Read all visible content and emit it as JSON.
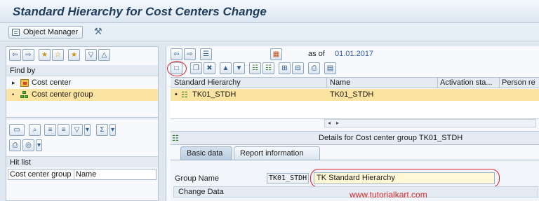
{
  "title": "Standard Hierarchy for Cost Centers Change",
  "app_toolbar": {
    "object_manager_label": "Object Manager"
  },
  "left_panel": {
    "find_by_label": "Find by",
    "tree_items": [
      {
        "label": "Cost center",
        "icon": "cost-center-icon",
        "selected": false
      },
      {
        "label": "Cost center group",
        "icon": "cost-center-group-icon",
        "selected": true
      }
    ],
    "hit_list_label": "Hit list",
    "hit_list_columns": [
      "Cost center group",
      "Name"
    ]
  },
  "right_panel": {
    "as_of_label": "as of",
    "as_of_date": "01.01.2017",
    "columns": [
      "Standard Hierarchy",
      "Name",
      "Activation sta...",
      "Person re"
    ],
    "rows": [
      {
        "standard_hierarchy": "TK01_STDH",
        "name": "TK01_STDH"
      }
    ],
    "details_title": "Details for Cost center group TK01_STDH",
    "tabs": [
      "Basic data",
      "Report information"
    ],
    "active_tab": "Basic data",
    "form": {
      "group_name_label": "Group Name",
      "group_name_value": "TK01_STDH",
      "description_value": "TK Standard Hierarchy",
      "change_data_label": "Change Data"
    }
  },
  "watermark": "www.tutorialkart.com",
  "colors": {
    "selection": "#fbe3a1",
    "title": "#1f3c5c",
    "highlight": "#e0202a",
    "date": "#2a55a8"
  }
}
